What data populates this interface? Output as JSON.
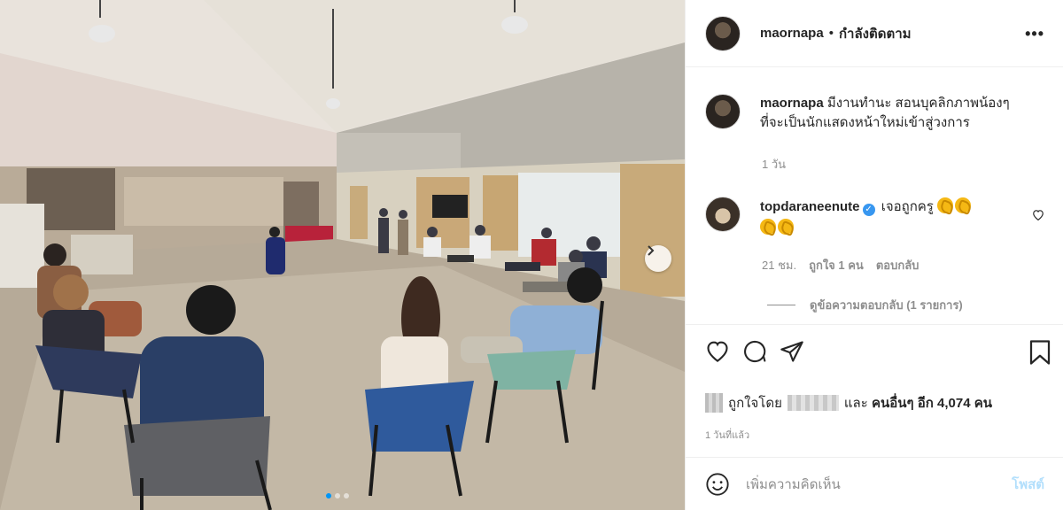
{
  "post": {
    "username": "maornapa",
    "separator": "•",
    "following_label": "กำลังติดตาม",
    "more_icon": "more-options-icon",
    "more_label": "•••",
    "caption": {
      "username": "maornapa",
      "text": "มีงานทำนะ สอนบุคลิกภาพน้องๆที่จะเป็นนักแสดงหน้าใหม่เข้าสู่วงการ",
      "time": "1 วัน"
    },
    "comment": {
      "username": "topdaraneenute",
      "verified": true,
      "text": "เจอถูกครู",
      "likes_text": "21 ชม.",
      "likes_count": "ถูกใจ 1 คน",
      "reply_label": "ตอบกลับ",
      "view_replies": "ดูข้อความตอบกลับ (1 รายการ)"
    },
    "likes": {
      "prefix": "ถูกใจโดย",
      "and": "และ",
      "others": "คนอื่นๆ อีก 4,074 คน"
    },
    "timestamp": "1 วันที่แล้ว",
    "add_comment_placeholder": "เพิ่มความคิดเห็น",
    "post_button": "โพสต์"
  },
  "carousel": {
    "count": 3,
    "active_index": 0
  },
  "colors": {
    "accent": "#0095f6",
    "post_button_disabled": "#b2dffc",
    "verified": "#3897f0"
  }
}
